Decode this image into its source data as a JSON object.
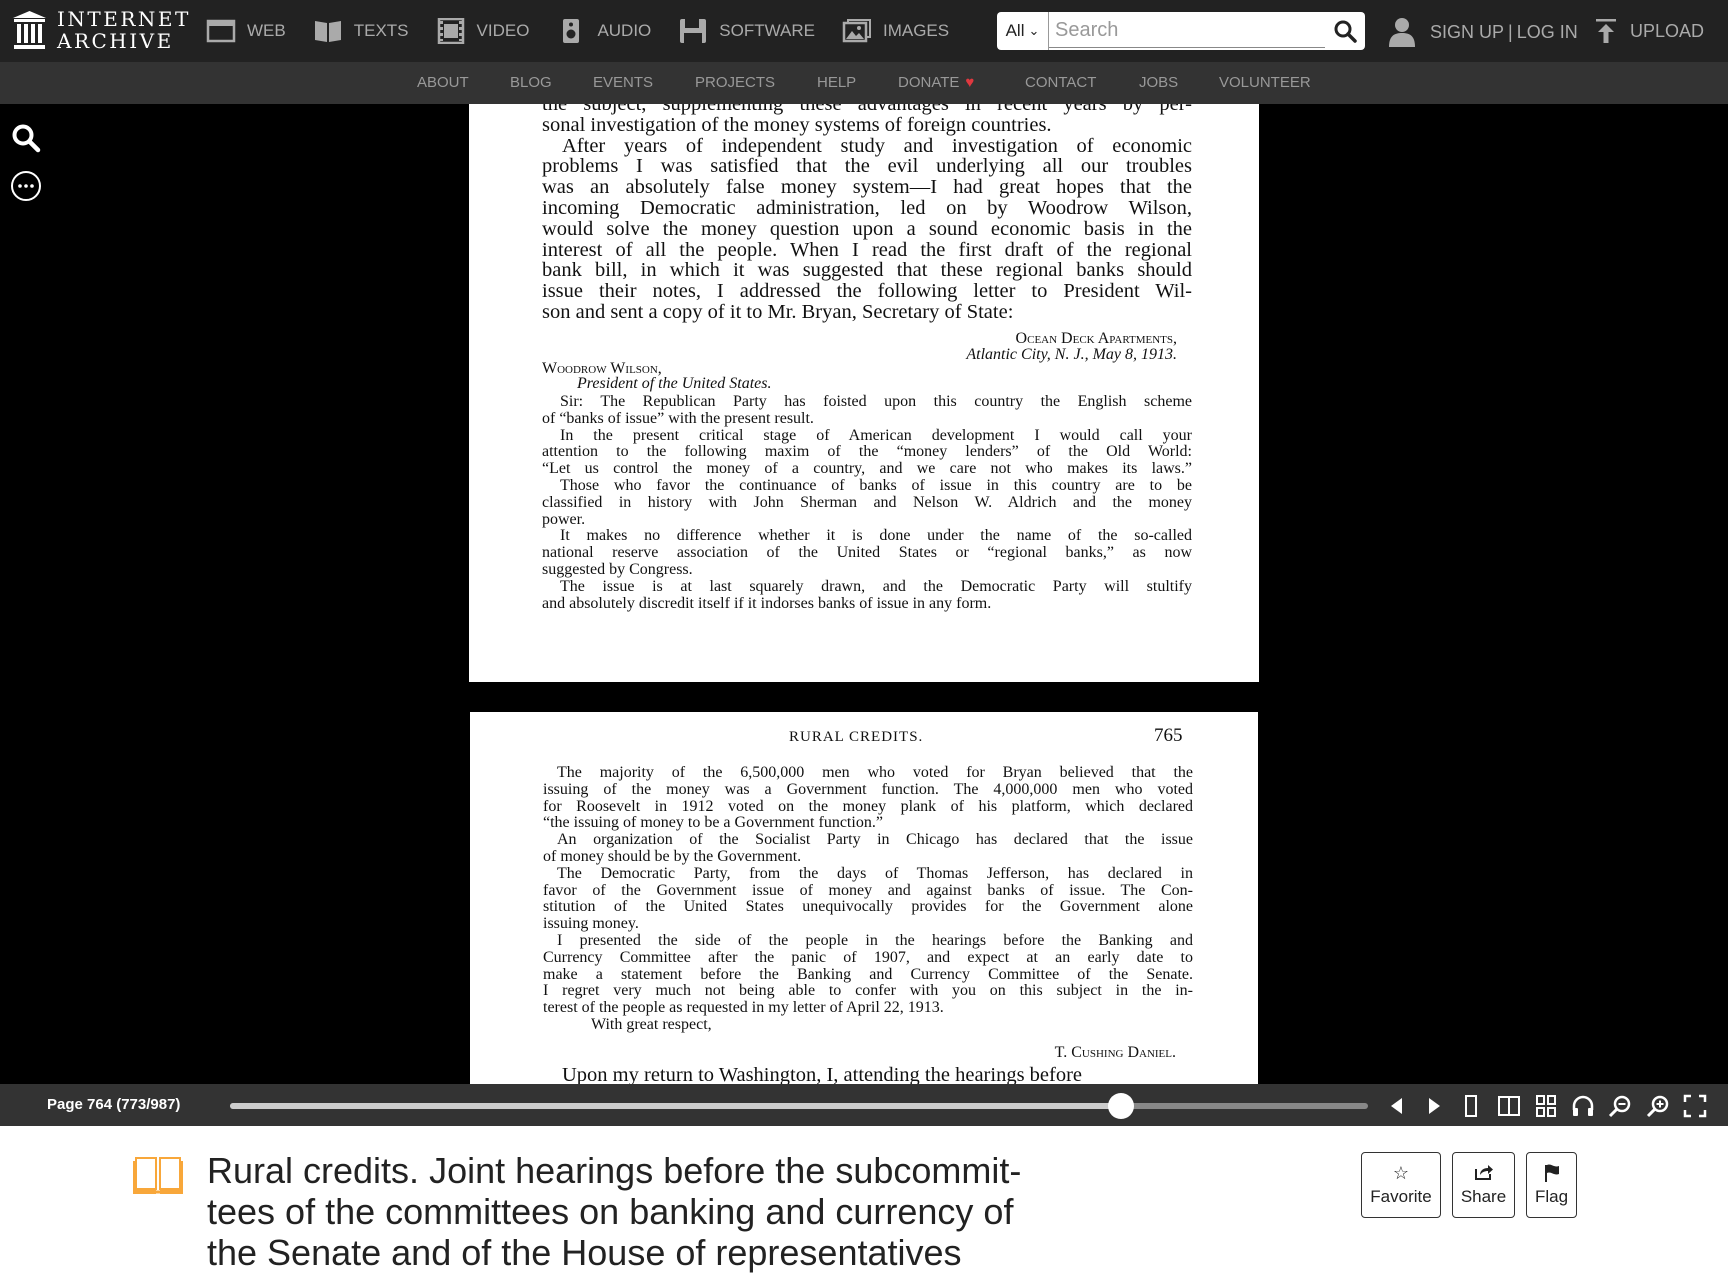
{
  "header": {
    "logo_line1": "INTERNET",
    "logo_line2": "ARCHIVE",
    "media_types": [
      {
        "label": "WEB",
        "icon": "web-icon"
      },
      {
        "label": "TEXTS",
        "icon": "texts-icon"
      },
      {
        "label": "VIDEO",
        "icon": "video-icon"
      },
      {
        "label": "AUDIO",
        "icon": "audio-icon"
      },
      {
        "label": "SOFTWARE",
        "icon": "software-icon"
      },
      {
        "label": "IMAGES",
        "icon": "images-icon"
      }
    ],
    "search": {
      "scope": "All",
      "placeholder": "Search"
    },
    "sign_up": "SIGN UP",
    "separator": "|",
    "log_in": "LOG IN",
    "upload": "UPLOAD"
  },
  "subnav": [
    "ABOUT",
    "BLOG",
    "EVENTS",
    "PROJECTS",
    "HELP",
    "DONATE",
    "CONTACT",
    "JOBS",
    "VOLUNTEER"
  ],
  "page_a": {
    "lines": [
      "the subject, supplementing these advantages in recent years by per-",
      "sonal investigation of the money systems of foreign countries.",
      "After years of independent study and investigation of economic",
      "problems I was satisfied that the evil underlying all our troubles",
      "was an absolutely false money system—I had great hopes that the",
      "incoming Democratic administration, led on by Woodrow Wilson,",
      "would solve the money question upon a sound economic basis in the",
      "interest of all the people.  When I read the first draft of the regional",
      "bank bill, in which it was suggested that these regional banks should",
      "issue their notes, I addressed the following letter to President Wil-",
      "son and sent a copy of it to Mr. Bryan, Secretary of State:"
    ],
    "address_line1": "Ocean Deck Apartments,",
    "address_line2": "Atlantic City, N. J., May 8, 1913.",
    "salutation_name": "Woodrow Wilson,",
    "salutation_title": "President of the United States.",
    "letter_lines": [
      "Sir: The Republican Party has foisted upon this country the English scheme",
      "of “banks of issue” with the present result.",
      "In the present critical stage of American development I would call your",
      "attention to the following maxim of the “money lenders” of the Old World:",
      "“Let us control the money of a country, and we care not who makes its laws.”",
      "Those who favor the continuance of banks of issue in this country are to be",
      "classified in history with John Sherman and Nelson W. Aldrich and the money",
      "power.",
      "It makes no difference whether it is done under the name of the so-called",
      "national reserve association of the United States or “regional banks,” as now",
      "suggested by Congress.",
      "The issue is at last squarely drawn, and the Democratic Party will stultify",
      "and absolutely discredit itself if it indorses banks of issue in any form."
    ]
  },
  "page_b": {
    "running_head": "RURAL CREDITS.",
    "page_number": "765",
    "lines": [
      "The majority of the 6,500,000 men who voted for Bryan believed that the",
      "issuing of the money was a Government function.  The 4,000,000 men who voted",
      "for Roosevelt in 1912 voted on the money plank of his platform, which declared",
      "“the issuing of money to be a Government function.”",
      "An organization of the Socialist Party in Chicago has declared that the issue",
      "of money should be by the Government.",
      "The Democratic Party, from the days of Thomas Jefferson, has declared in",
      "favor of the Government issue of money and against banks of issue.  The Con-",
      "stitution of the United States unequivocally provides for the Government alone",
      "issuing money.",
      "I presented the side of the people in the hearings before the Banking and",
      "Currency Committee after the panic of 1907, and expect at an early date to",
      "make a statement before the Banking and Currency Committee of the Senate.",
      "I regret very much not being able to confer with you on this subject in the in-",
      "terest of the people as requested in my letter of April 22, 1913.",
      "With great respect,"
    ],
    "signature": "T. Cushing Daniel.",
    "continuation": "Upon my return to Washington, I, attending the hearings before"
  },
  "toolbar": {
    "page_label": "Page 764 (773/987)",
    "progress": 0.783
  },
  "item": {
    "title": "Rural credits. Joint hearings before the subcommittees of the committees on banking and currency of the Senate and of the House of representatives",
    "title_lines": [
      "Rural credits. Joint hearings before the subcommit-",
      "tees of the committees on banking and currency of",
      "the Senate and of the House of representatives"
    ],
    "actions": {
      "favorite": "Favorite",
      "share": "Share",
      "flag": "Flag"
    }
  },
  "colors": {
    "accent_orange": "#f8a73a",
    "donate_heart": "#e0383f",
    "nav_bg": "#222222",
    "subnav_bg": "#333333"
  }
}
